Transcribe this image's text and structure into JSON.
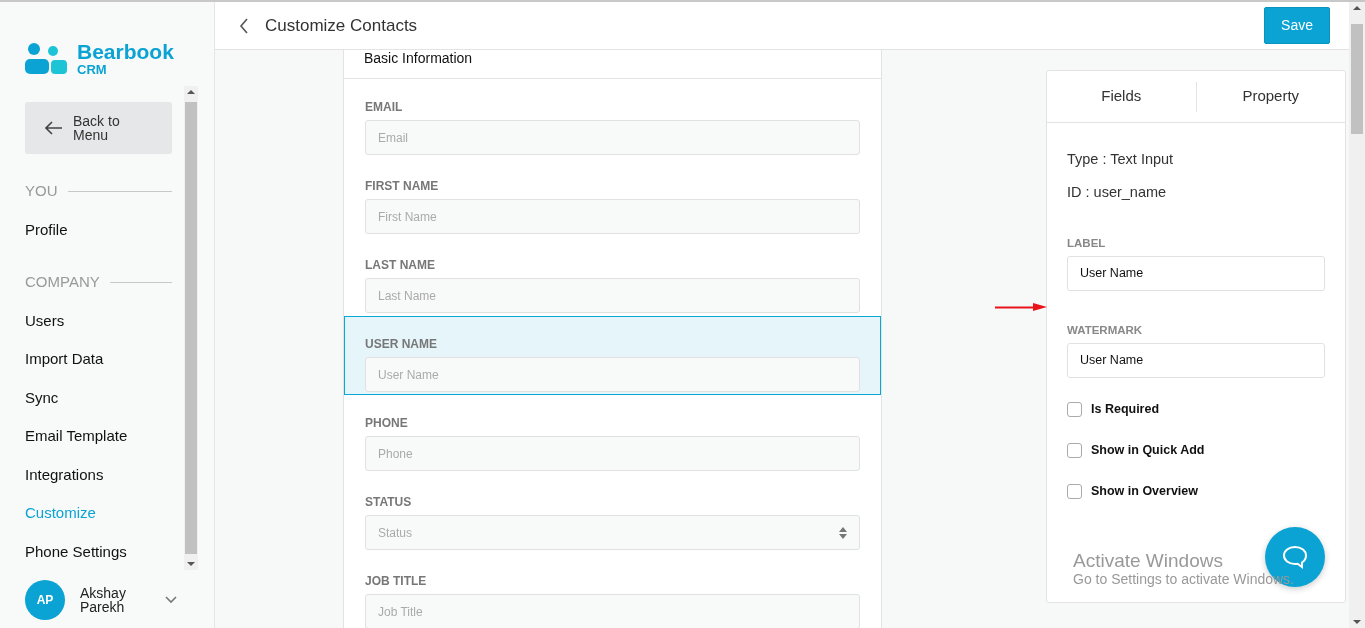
{
  "brand": {
    "name": "Bearbook",
    "sub": "CRM"
  },
  "back_button": "Back to Menu",
  "sidebar": {
    "sections": [
      {
        "title": "YOU",
        "items": [
          {
            "label": "Profile",
            "selected": false
          }
        ]
      },
      {
        "title": "COMPANY",
        "items": [
          {
            "label": "Users",
            "selected": false
          },
          {
            "label": "Import Data",
            "selected": false
          },
          {
            "label": "Sync",
            "selected": false
          },
          {
            "label": "Email Template",
            "selected": false
          },
          {
            "label": "Integrations",
            "selected": false
          },
          {
            "label": "Customize",
            "selected": true
          },
          {
            "label": "Phone Settings",
            "selected": false
          }
        ]
      }
    ]
  },
  "user": {
    "initials": "AP",
    "name": "Akshay Parekh"
  },
  "header": {
    "title": "Customize Contacts",
    "save": "Save"
  },
  "form": {
    "section": "Basic Information",
    "fields": [
      {
        "label": "EMAIL",
        "placeholder": "Email",
        "kind": "text",
        "selected": false
      },
      {
        "label": "FIRST NAME",
        "placeholder": "First Name",
        "kind": "text",
        "selected": false
      },
      {
        "label": "LAST NAME",
        "placeholder": "Last Name",
        "kind": "text",
        "selected": false
      },
      {
        "label": "USER NAME",
        "placeholder": "User Name",
        "kind": "text",
        "selected": true
      },
      {
        "label": "PHONE",
        "placeholder": "Phone",
        "kind": "text",
        "selected": false
      },
      {
        "label": "STATUS",
        "placeholder": "Status",
        "kind": "select",
        "selected": false
      },
      {
        "label": "JOB TITLE",
        "placeholder": "Job Title",
        "kind": "text",
        "selected": false
      }
    ]
  },
  "panel": {
    "tabs": [
      "Fields",
      "Property"
    ],
    "type": "Type : Text Input",
    "id": "ID : user_name",
    "inputs": [
      {
        "label": "LABEL",
        "value": "User Name"
      },
      {
        "label": "WATERMARK",
        "value": "User Name"
      }
    ],
    "options": [
      {
        "label": "Is Required",
        "checked": false
      },
      {
        "label": "Show in Quick Add",
        "checked": false
      },
      {
        "label": "Show in Overview",
        "checked": false
      }
    ]
  },
  "os_notice": {
    "title": "Activate Windows",
    "text": "Go to Settings to activate Windows."
  }
}
